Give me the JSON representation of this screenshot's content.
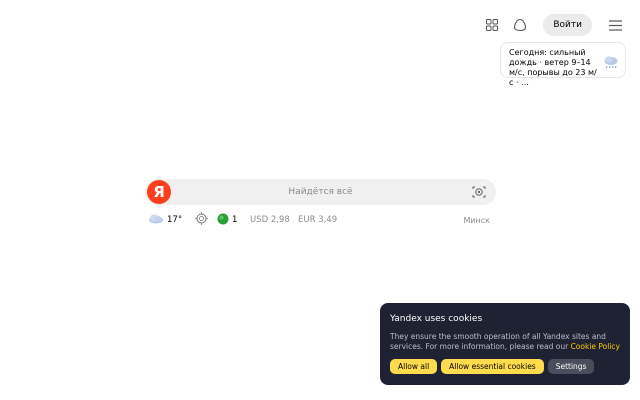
{
  "header": {
    "login_label": "Войти",
    "icons": [
      "apps-grid-icon",
      "alice-icon",
      "menu-icon"
    ]
  },
  "weather_card": {
    "text": "Сегодня: сильный дождь · ветер 9–14 м/с, порывы до 23 м/с · …",
    "icon": "rain-cloud-icon"
  },
  "search": {
    "logo": "Я",
    "placeholder": "Найдётся всё",
    "camera_icon": "camera-search-icon"
  },
  "info_row": {
    "temperature": "17°",
    "traffic_score": "1",
    "usd": "USD 2,98",
    "eur": "EUR 3,49",
    "city": "Минск"
  },
  "cookie_banner": {
    "title": "Yandex uses cookies",
    "body": "They ensure the smooth operation of all Yandex sites and services. For more information, please read our",
    "link": "Cookie Policy",
    "allow_all": "Allow all",
    "allow_essential": "Allow essential cookies",
    "settings": "Settings"
  },
  "colors": {
    "brand_red": "#fc3f1d",
    "cookie_bg": "#1f2233",
    "accent_yellow": "#ffdb4d"
  }
}
